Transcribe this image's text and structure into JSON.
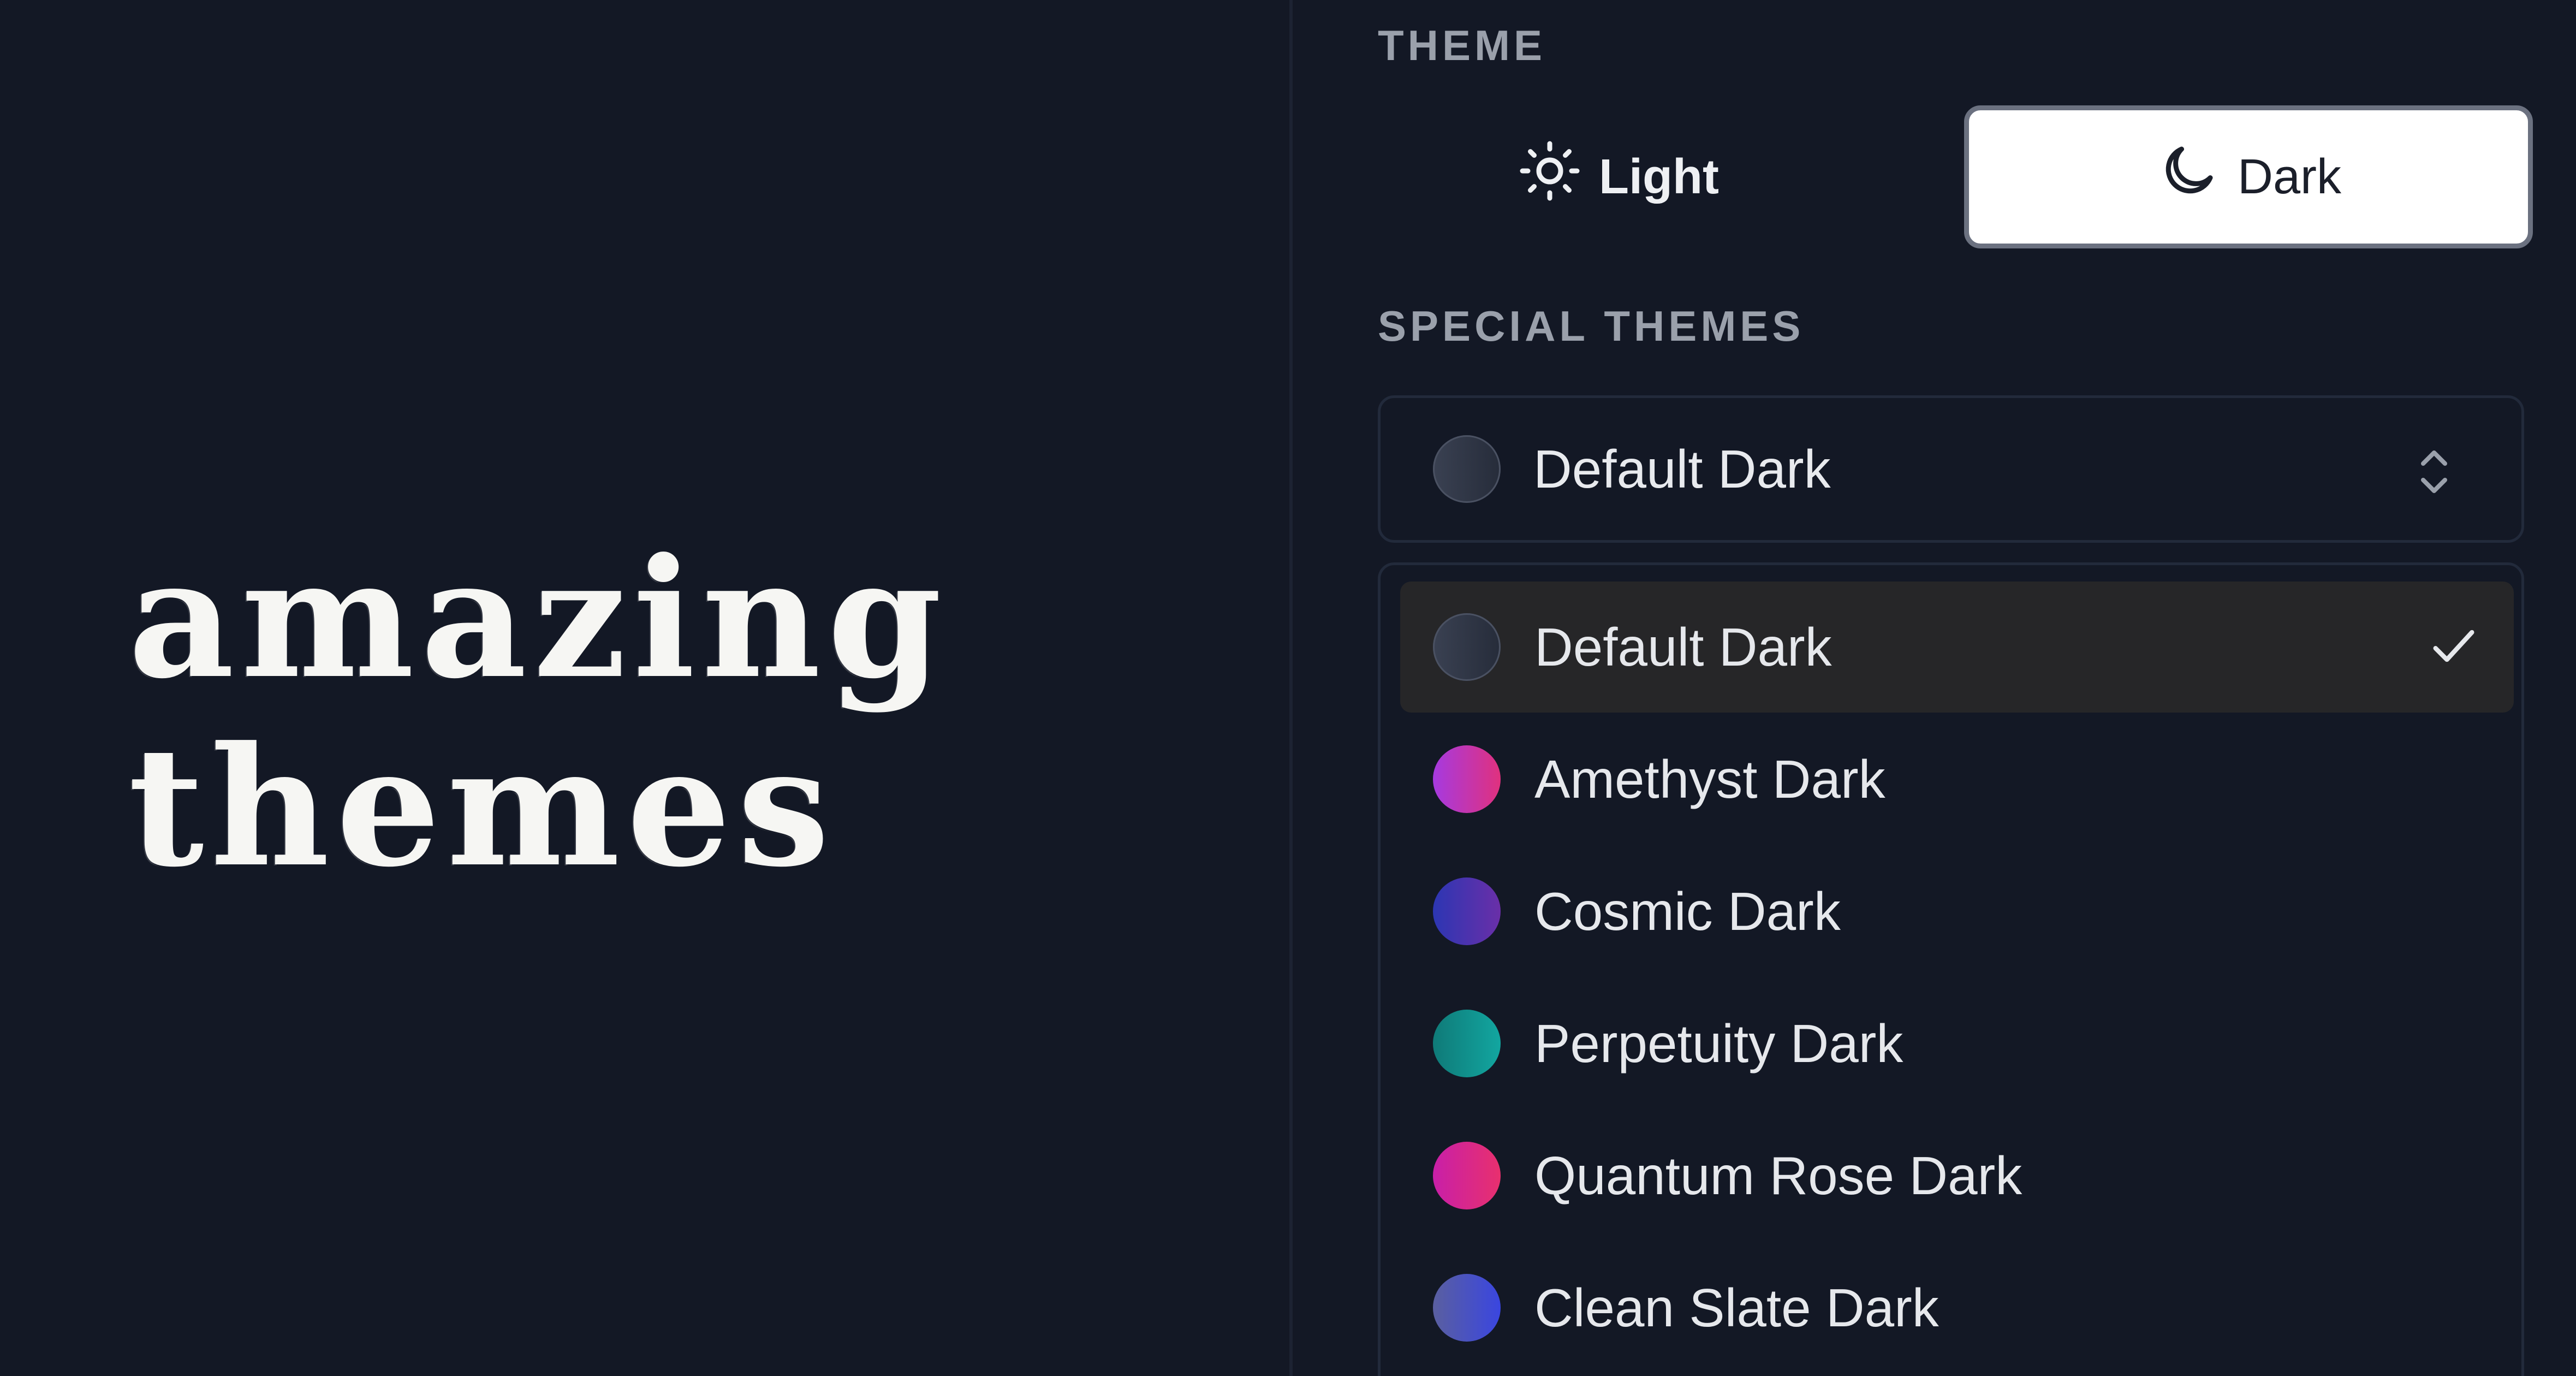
{
  "hero": {
    "line1": "amazing",
    "line2": "themes"
  },
  "theme_section": {
    "label": "THEME",
    "light_label": "Light",
    "dark_label": "Dark",
    "selected_mode": "Dark"
  },
  "special_section": {
    "label": "SPECIAL THEMES",
    "current_value": "Default Dark",
    "current_swatch": [
      "#3a4152",
      "#262c3a"
    ],
    "options": [
      {
        "label": "Default Dark",
        "selected": true,
        "swatch": [
          "#3a4152",
          "#262c3a"
        ]
      },
      {
        "label": "Amethyst Dark",
        "selected": false,
        "swatch": [
          "#a63ae0",
          "#e0317e"
        ]
      },
      {
        "label": "Cosmic Dark",
        "selected": false,
        "swatch": [
          "#2c36b3",
          "#6a2fa8"
        ]
      },
      {
        "label": "Perpetuity Dark",
        "selected": false,
        "swatch": [
          "#0f7a78",
          "#12a6a0"
        ]
      },
      {
        "label": "Quantum Rose Dark",
        "selected": false,
        "swatch": [
          "#c81fa8",
          "#e8306e"
        ]
      },
      {
        "label": "Clean Slate Dark",
        "selected": false,
        "swatch": [
          "#5a5fa0",
          "#3a46e0"
        ]
      }
    ]
  },
  "colors": {
    "background": "#131825",
    "border": "#222a3b",
    "selected_row": "#262628",
    "label_muted": "#9aa0ab"
  }
}
